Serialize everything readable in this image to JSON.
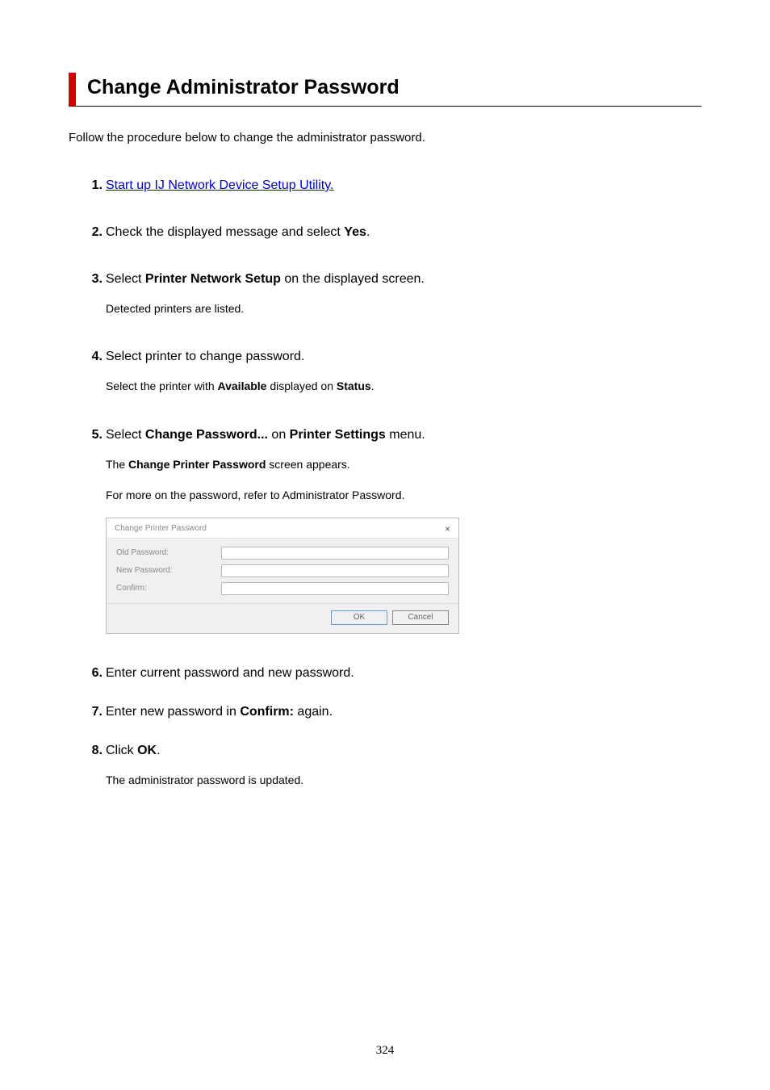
{
  "title": "Change Administrator Password",
  "intro": "Follow the procedure below to change the administrator password.",
  "steps": {
    "s1": {
      "num": "1.",
      "link": "Start up IJ Network Device Setup Utility."
    },
    "s2": {
      "num": "2.",
      "text_a": "Check the displayed message and select ",
      "bold_a": "Yes",
      "text_b": "."
    },
    "s3": {
      "num": "3.",
      "text_a": "Select ",
      "bold_a": "Printer Network Setup",
      "text_b": " on the displayed screen.",
      "sub": "Detected printers are listed."
    },
    "s4": {
      "num": "4.",
      "text_a": "Select printer to change password.",
      "sub_a": "Select the printer with ",
      "sub_bold_a": "Available",
      "sub_b": " displayed on ",
      "sub_bold_b": "Status",
      "sub_c": "."
    },
    "s5": {
      "num": "5.",
      "text_a": "Select ",
      "bold_a": "Change Password...",
      "text_b": " on ",
      "bold_b": "Printer Settings",
      "text_c": " menu.",
      "sub1_a": "The ",
      "sub1_bold": "Change Printer Password",
      "sub1_b": " screen appears.",
      "sub2": "For more on the password, refer to Administrator Password."
    },
    "s6": {
      "num": "6.",
      "text_a": "Enter current password and new password."
    },
    "s7": {
      "num": "7.",
      "text_a": "Enter new password in ",
      "bold_a": "Confirm:",
      "text_b": " again."
    },
    "s8": {
      "num": "8.",
      "text_a": "Click ",
      "bold_a": "OK",
      "text_b": ".",
      "sub": "The administrator password is updated."
    }
  },
  "dialog": {
    "title": "Change Printer Password",
    "close": "×",
    "old": "Old Password:",
    "new": "New Password:",
    "confirm": "Confirm:",
    "ok": "OK",
    "cancel": "Cancel"
  },
  "page_number": "324"
}
